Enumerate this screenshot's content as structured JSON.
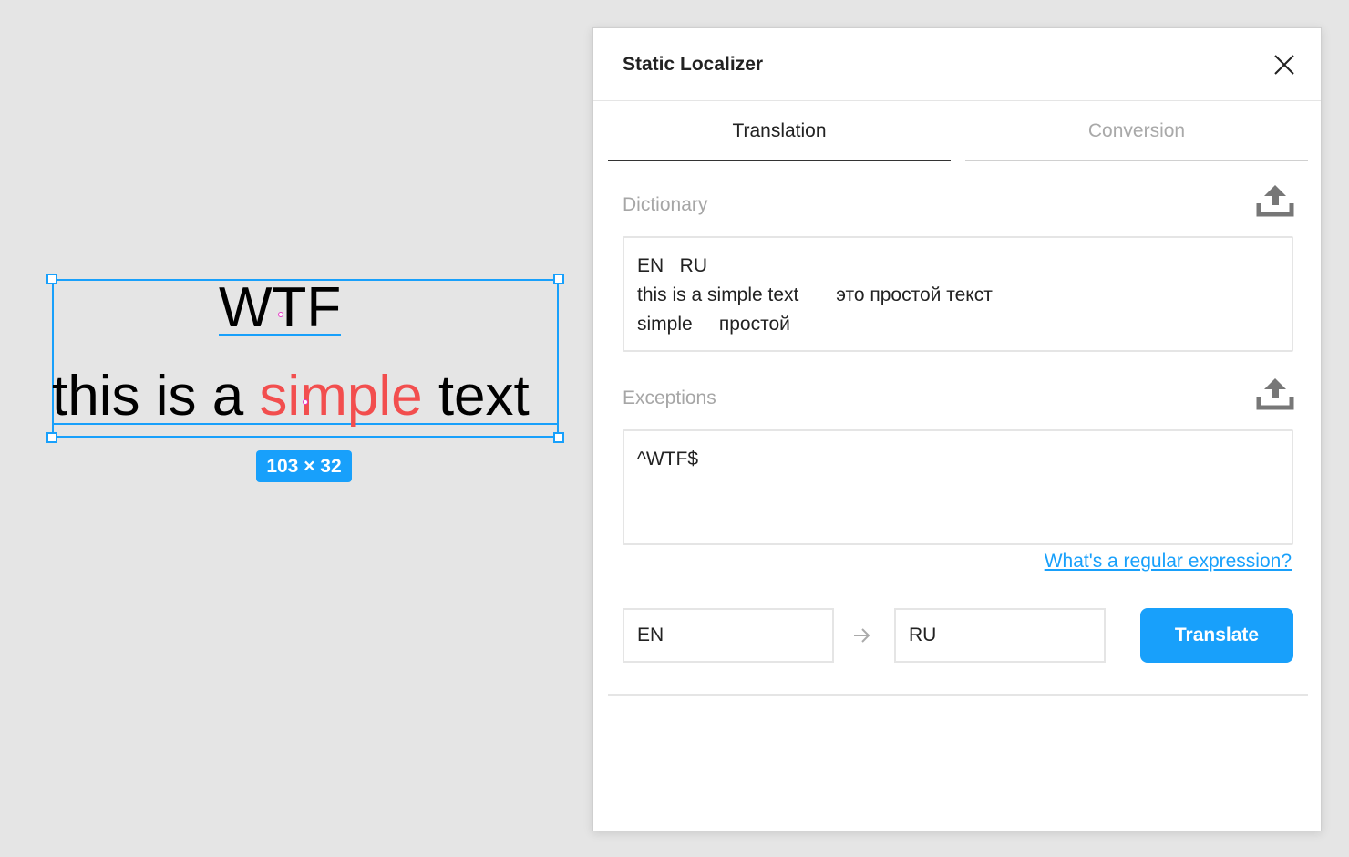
{
  "canvas": {
    "heading_text": "WTF",
    "body_text": {
      "before": "this is a ",
      "highlight": "simple",
      "after": " text"
    },
    "selection_size": "103 × 32",
    "colors": {
      "selection": "#18a0fb",
      "highlight": "#f24e4e"
    }
  },
  "panel": {
    "title": "Static Localizer",
    "close_icon": "close-icon",
    "tabs": [
      {
        "label": "Translation",
        "active": true
      },
      {
        "label": "Conversion",
        "active": false
      }
    ],
    "dictionary": {
      "label": "Dictionary",
      "upload_icon": "upload-icon",
      "value": "EN   RU\nthis is a simple text       это простой текст\nsimple     простой"
    },
    "exceptions": {
      "label": "Exceptions",
      "upload_icon": "upload-icon",
      "value": "^WTF$",
      "help_link": "What's a regular expression?"
    },
    "languages": {
      "from": "EN",
      "to": "RU",
      "arrow_icon": "arrow-right-icon"
    },
    "translate_button": "Translate",
    "colors": {
      "accent": "#18a0fb",
      "muted": "#a6a6a6"
    }
  }
}
